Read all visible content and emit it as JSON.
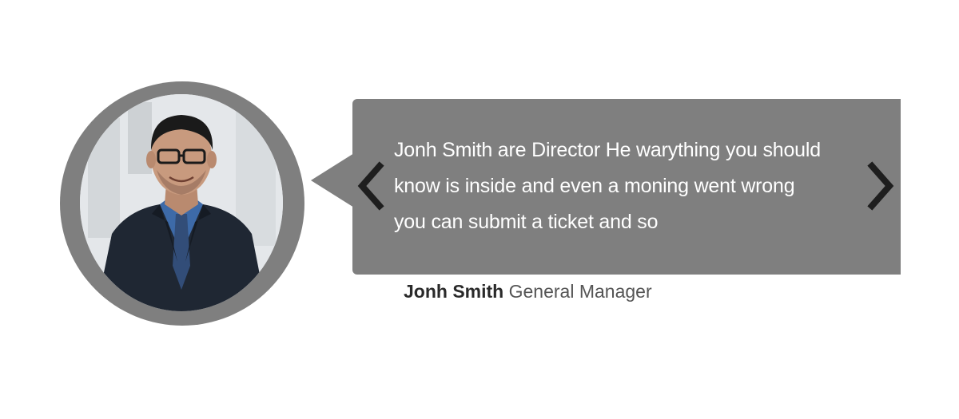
{
  "testimonial": {
    "quote_lines": [
      "Jonh Smith are Director He warything you should",
      "know is inside and even a moning went wrong",
      "you can submit a ticket and so"
    ],
    "author_name": "Jonh Smith",
    "author_role": "General Manager"
  },
  "navigation": {
    "prev_icon": "chevron-left-icon",
    "next_icon": "chevron-right-icon"
  },
  "colors": {
    "bubble": "#7f7f7f",
    "quote_text": "#ffffff",
    "arrow": "#1e1e1e",
    "author_name": "#2a2a2a",
    "author_role": "#555555"
  }
}
